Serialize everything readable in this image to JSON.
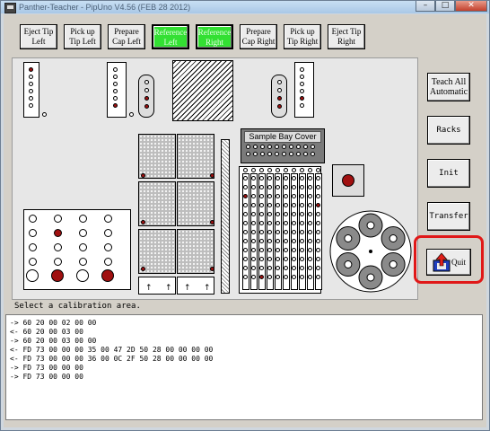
{
  "window": {
    "title": "Panther-Teacher - PipUno   V4.56 (FEB 28 2012)",
    "min_glyph": "–",
    "max_glyph": "□",
    "close_glyph": "✕"
  },
  "toolbar": [
    {
      "line1": "Eject Tip",
      "line2": "Left",
      "active": false
    },
    {
      "line1": "Pick up",
      "line2": "Tip Left",
      "active": false
    },
    {
      "line1": "Prepare",
      "line2": "Cap Left",
      "active": false
    },
    {
      "line1": "Reference",
      "line2": "Left",
      "active": true
    },
    {
      "line1": "Reference",
      "line2": "Right",
      "active": true
    },
    {
      "line1": "Prepare",
      "line2": "Cap Right",
      "active": false
    },
    {
      "line1": "Pick up",
      "line2": "Tip Right",
      "active": false
    },
    {
      "line1": "Eject Tip",
      "line2": "Right",
      "active": false
    }
  ],
  "deck": {
    "sample_bay_cover": "Sample Bay Cover"
  },
  "side_buttons": {
    "teach_line1": "Teach All",
    "teach_line2": "Automatic",
    "racks": "Racks",
    "init": "Init",
    "transfer": "Transfer",
    "quit": "Quit"
  },
  "status": "Select a calibration area.",
  "log": [
    "-> 60 20 00 02 00 00",
    "<- 60 20 00 03 00",
    "-> 60 20 00 03 00 00",
    "<- FD 73 00 00 00 35 00 47 2D 50 28 00 00 00 00",
    "<- FD 73 00 00 00 36 00 0C 2F 50 28 00 00 00 00",
    "-> FD 73 00 00 00",
    "-> FD 73 00 00 00"
  ],
  "colors": {
    "active_button": "#33e033",
    "highlight": "#e01818",
    "red_dot": "#a01010"
  }
}
